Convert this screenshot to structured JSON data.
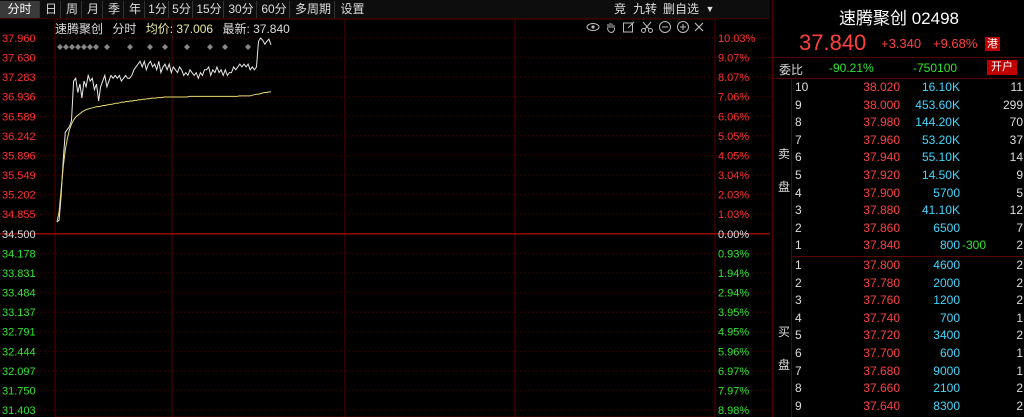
{
  "toolbar": {
    "tabs": [
      {
        "label": "分时",
        "active": true
      },
      {
        "label": "日"
      },
      {
        "label": "周"
      },
      {
        "label": "月"
      },
      {
        "label": "季"
      },
      {
        "label": "年"
      },
      {
        "label": "1分"
      },
      {
        "label": "5分"
      },
      {
        "label": "15分"
      },
      {
        "label": "30分"
      },
      {
        "label": "60分"
      },
      {
        "label": "多周期"
      },
      {
        "label": "设置"
      }
    ],
    "right": [
      "竞",
      "九转",
      "删自选"
    ]
  },
  "chart_header": {
    "name": "速腾聚创",
    "timeframe": "分时",
    "avg_label": "均价: 37.006",
    "last_label": "最新: 37.840"
  },
  "chart_data": {
    "type": "line",
    "prev_close": 34.5,
    "ylim": [
      31.403,
      37.96
    ],
    "price_ticks": [
      "37.960",
      "37.630",
      "37.283",
      "36.936",
      "36.589",
      "36.242",
      "35.896",
      "35.549",
      "35.202",
      "34.855",
      "34.500",
      "34.178",
      "33.831",
      "33.484",
      "33.137",
      "32.791",
      "32.444",
      "32.097",
      "31.750",
      "31.403"
    ],
    "pct_ticks": [
      "10.03%",
      "9.07%",
      "8.07%",
      "7.06%",
      "6.06%",
      "5.05%",
      "4.05%",
      "3.04%",
      "2.03%",
      "1.03%",
      "0.00%",
      "0.93%",
      "1.94%",
      "2.94%",
      "3.95%",
      "4.95%",
      "5.96%",
      "6.97%",
      "7.97%",
      "8.98%"
    ],
    "series": [
      {
        "values": [
          34.72,
          34.75,
          35.2,
          35.8,
          36.3,
          36.35,
          36.4,
          36.5,
          37.2,
          37.25,
          37.0,
          37.15,
          36.9,
          37.2,
          37.1,
          37.3,
          37.2,
          37.25,
          37.05,
          37.15,
          36.85,
          37.1,
          37.2,
          37.3,
          37.1,
          37.2,
          37.3,
          37.25,
          37.3,
          37.25,
          37.3,
          37.2,
          37.25,
          37.3,
          37.25,
          37.25,
          37.3,
          37.4,
          37.45,
          37.5,
          37.55,
          37.45,
          37.55,
          37.4,
          37.5,
          37.55,
          37.45,
          37.5,
          37.4,
          37.55,
          37.35,
          37.45,
          37.5,
          37.4,
          37.5,
          37.35,
          37.45,
          37.4,
          37.35,
          37.45,
          37.4,
          37.3,
          37.35,
          37.3,
          37.4,
          37.35,
          37.3,
          37.35,
          37.25,
          37.35,
          37.3,
          37.4,
          37.4,
          37.45,
          37.3,
          37.4,
          37.35,
          37.45,
          37.35,
          37.4,
          37.3,
          37.4,
          37.3,
          37.35,
          37.35,
          37.45,
          37.4,
          37.45,
          37.5,
          37.45,
          37.5,
          37.45,
          37.5,
          37.4,
          37.45,
          37.4,
          37.45,
          37.9,
          37.96,
          37.92,
          37.85,
          37.9,
          37.94,
          37.84
        ]
      },
      {
        "values": [
          34.72,
          34.9,
          35.3,
          35.7,
          36.0,
          36.2,
          36.35,
          36.45,
          36.52,
          36.57,
          36.6,
          36.63,
          36.66,
          36.68,
          36.7,
          36.71,
          36.72,
          36.73,
          36.74,
          36.75,
          36.75,
          36.76,
          36.77,
          36.77,
          36.78,
          36.79,
          36.79,
          36.8,
          36.81,
          36.81,
          36.82,
          36.83,
          36.83,
          36.84,
          36.84,
          36.85,
          36.85,
          36.86,
          36.86,
          36.87,
          36.87,
          36.88,
          36.88,
          36.89,
          36.89,
          36.9,
          36.9,
          36.9,
          36.91,
          36.91,
          36.91,
          36.92,
          36.92,
          36.92,
          36.92,
          36.92,
          36.92,
          36.92,
          36.92,
          36.92,
          36.92,
          36.92,
          36.92,
          36.93,
          36.93,
          36.93,
          36.93,
          36.93,
          36.93,
          36.93,
          36.93,
          36.93,
          36.93,
          36.93,
          36.93,
          36.93,
          36.93,
          36.93,
          36.93,
          36.93,
          36.93,
          36.93,
          36.93,
          36.93,
          36.93,
          36.93,
          36.93,
          36.94,
          36.94,
          36.94,
          36.94,
          36.94,
          36.94,
          36.95,
          36.96,
          36.97,
          36.97,
          36.98,
          36.99,
          37.0,
          37.0,
          37.01,
          37.01
        ]
      }
    ]
  },
  "panel": {
    "title": "速腾聚创 02498",
    "price": "37.840",
    "change": "+3.340",
    "change_pct": "+9.68%",
    "market_badge": "港",
    "weibi_label": "委比",
    "weibi_ratio": "-90.21%",
    "weibi_diff": "-750100",
    "open_account_btn": "开户",
    "sell_label": [
      "卖",
      "盘"
    ],
    "buy_label": [
      "买",
      "盘"
    ],
    "asks": [
      {
        "level": "10",
        "price": "38.020",
        "volume": "16.10K",
        "change": "",
        "count": "11"
      },
      {
        "level": "9",
        "price": "38.000",
        "volume": "453.60K",
        "change": "",
        "count": "299"
      },
      {
        "level": "8",
        "price": "37.980",
        "volume": "144.20K",
        "change": "",
        "count": "70"
      },
      {
        "level": "7",
        "price": "37.960",
        "volume": "53.20K",
        "change": "",
        "count": "37"
      },
      {
        "level": "6",
        "price": "37.940",
        "volume": "55.10K",
        "change": "",
        "count": "14"
      },
      {
        "level": "5",
        "price": "37.920",
        "volume": "14.50K",
        "change": "",
        "count": "9"
      },
      {
        "level": "4",
        "price": "37.900",
        "volume": "5700",
        "change": "",
        "count": "5"
      },
      {
        "level": "3",
        "price": "37.880",
        "volume": "41.10K",
        "change": "",
        "count": "12"
      },
      {
        "level": "2",
        "price": "37.860",
        "volume": "6500",
        "change": "",
        "count": "7"
      },
      {
        "level": "1",
        "price": "37.840",
        "volume": "800",
        "change": "-300",
        "count": "2"
      }
    ],
    "bids": [
      {
        "level": "1",
        "price": "37.800",
        "volume": "4600",
        "count": "2"
      },
      {
        "level": "2",
        "price": "37.780",
        "volume": "2000",
        "count": "2"
      },
      {
        "level": "3",
        "price": "37.760",
        "volume": "1200",
        "count": "2"
      },
      {
        "level": "4",
        "price": "37.740",
        "volume": "700",
        "count": "1"
      },
      {
        "level": "5",
        "price": "37.720",
        "volume": "3400",
        "count": "2"
      },
      {
        "level": "6",
        "price": "37.700",
        "volume": "600",
        "count": "1"
      },
      {
        "level": "7",
        "price": "37.680",
        "volume": "9000",
        "count": "1"
      },
      {
        "level": "8",
        "price": "37.660",
        "volume": "2100",
        "count": "2"
      },
      {
        "level": "9",
        "price": "37.640",
        "volume": "8300",
        "count": "2"
      }
    ]
  }
}
